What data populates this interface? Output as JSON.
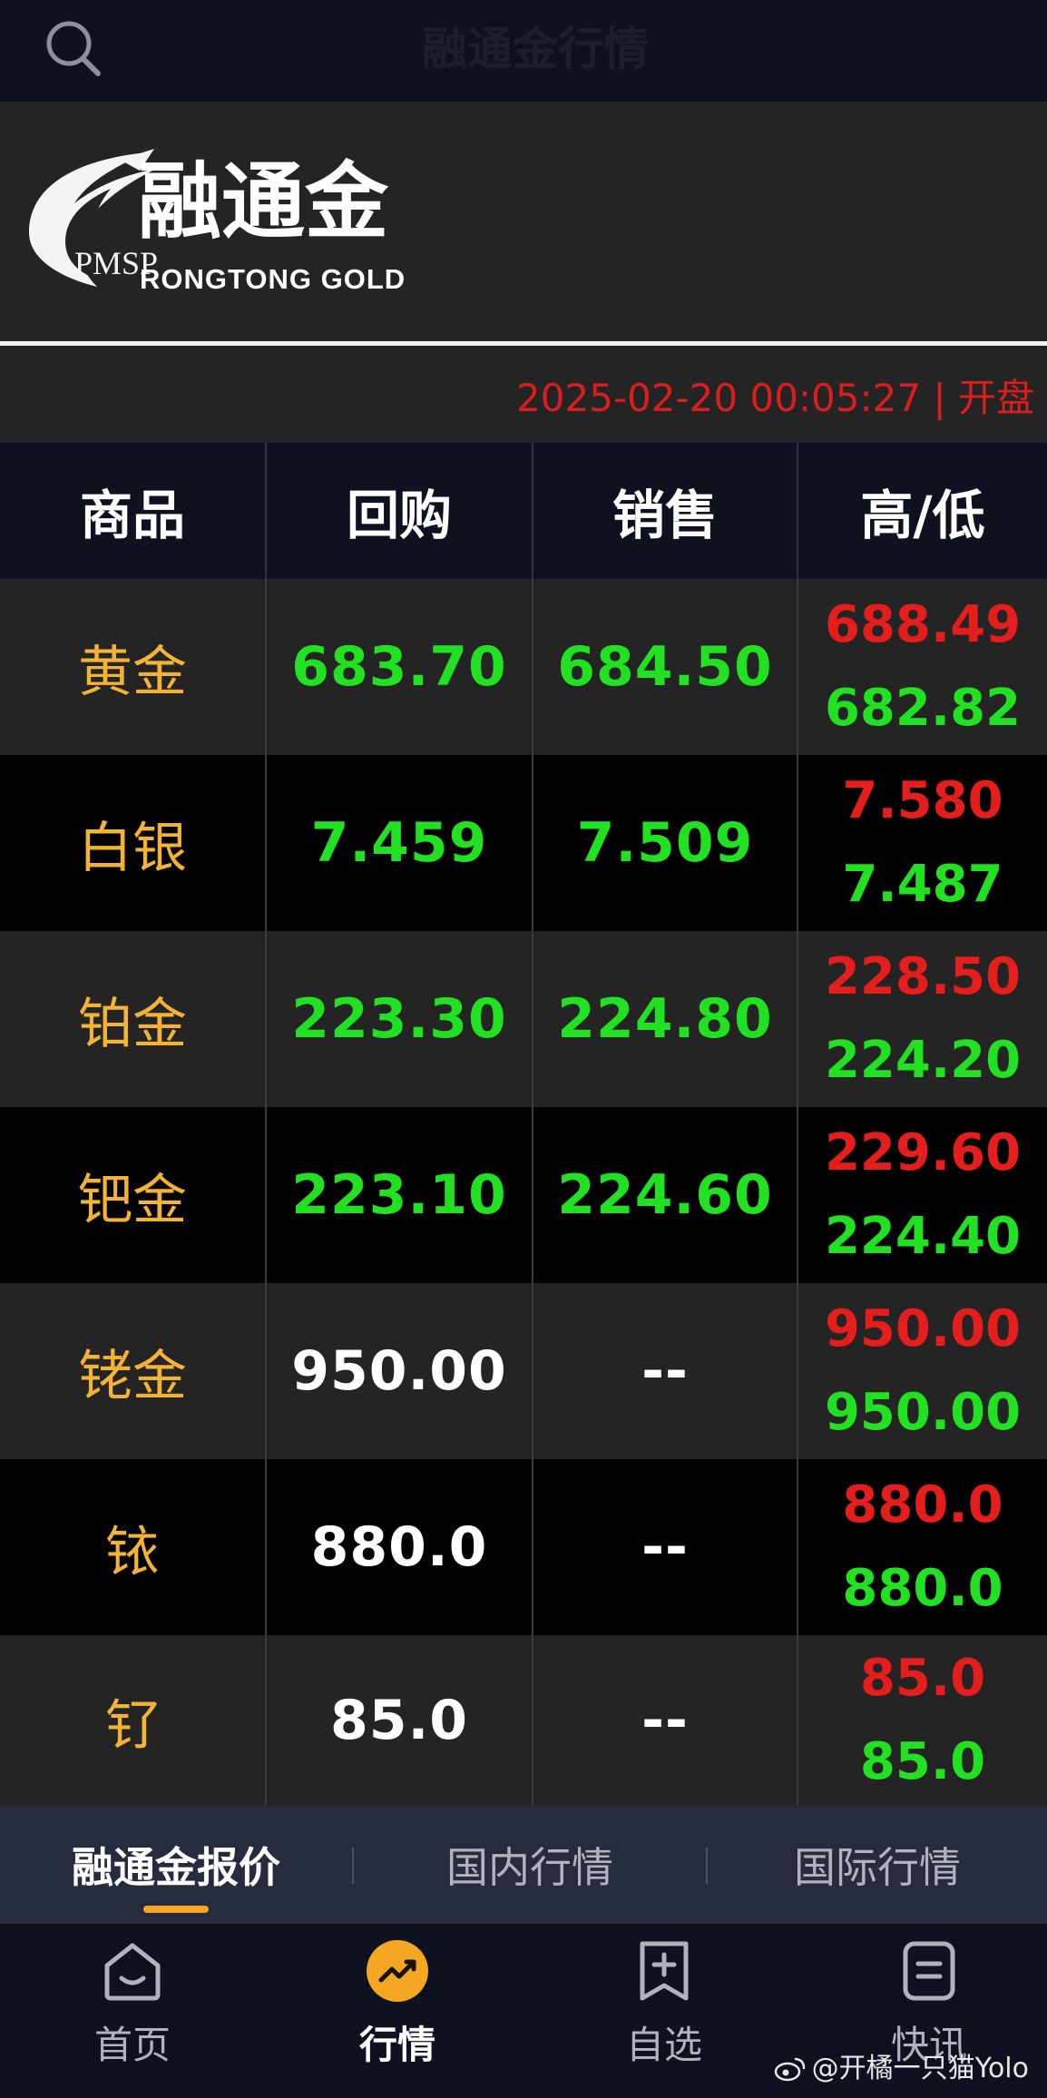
{
  "app_bar": {
    "title": "融通金行情"
  },
  "brand": {
    "abbr": "PMSP",
    "name_cn": "融通金",
    "name_en": "RONGTONG GOLD"
  },
  "status": {
    "timestamp": "2025-02-20 00:05:27",
    "separator": "|",
    "market_state": "开盘"
  },
  "table": {
    "headers": [
      "商品",
      "回购",
      "销售",
      "高/低"
    ],
    "rows": [
      {
        "name": "黄金",
        "buyback": "683.70",
        "sell": "684.50",
        "high": "688.49",
        "low": "682.82"
      },
      {
        "name": "白银",
        "buyback": "7.459",
        "sell": "7.509",
        "high": "7.580",
        "low": "7.487"
      },
      {
        "name": "铂金",
        "buyback": "223.30",
        "sell": "224.80",
        "high": "228.50",
        "low": "224.20"
      },
      {
        "name": "钯金",
        "buyback": "223.10",
        "sell": "224.60",
        "high": "229.60",
        "low": "224.40"
      },
      {
        "name": "铑金",
        "buyback": "950.00",
        "sell": "--",
        "high": "950.00",
        "low": "950.00"
      },
      {
        "name": "铱",
        "buyback": "880.0",
        "sell": "--",
        "high": "880.0",
        "low": "880.0"
      },
      {
        "name": "钌",
        "buyback": "85.0",
        "sell": "--",
        "high": "85.0",
        "low": "85.0"
      }
    ]
  },
  "sub_tabs": [
    {
      "label": "融通金报价",
      "active": true
    },
    {
      "label": "国内行情",
      "active": false
    },
    {
      "label": "国际行情",
      "active": false
    }
  ],
  "bottom_nav": [
    {
      "label": "首页",
      "icon": "home-icon"
    },
    {
      "label": "行情",
      "icon": "market-trend-icon",
      "active": true
    },
    {
      "label": "自选",
      "icon": "add-favorite-icon"
    },
    {
      "label": "快讯",
      "icon": "news-icon"
    }
  ],
  "watermark": {
    "text": "@开橘一只猫Yolo",
    "icon": "weibo-icon"
  },
  "colors": {
    "up_red": "#e41d1d",
    "down_green": "#22e022",
    "name_gold": "#f2b336",
    "accent_orange": "#f5a623",
    "header_navy": "#0e1220"
  }
}
